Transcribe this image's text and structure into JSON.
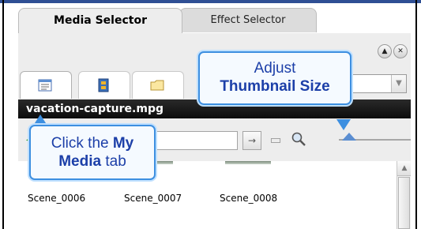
{
  "tabs": [
    {
      "label": "Media Selector",
      "active": true
    },
    {
      "label": "Effect Selector",
      "active": false
    }
  ],
  "controls": {
    "collapse_icon": "chevron-up-circle-icon",
    "close_icon": "close-circle-icon"
  },
  "icon_tabs": [
    {
      "name": "my-media",
      "icon": "list-icon"
    },
    {
      "name": "media-library",
      "icon": "film-icon"
    },
    {
      "name": "folder",
      "icon": "folder-icon"
    }
  ],
  "title_bar": {
    "text": "vacation-capture.mpg"
  },
  "toolbar": {
    "go_icon": "arrow-right-icon",
    "monitor_icon": "monitor-icon",
    "zoom_icon": "magnifier-icon"
  },
  "scenes": [
    "Scene_0006",
    "Scene_0007",
    "Scene_0008"
  ],
  "callouts": {
    "thumbnail": {
      "line1": "Adjust",
      "line2": "Thumbnail Size"
    },
    "my_media": {
      "pre": "Click the ",
      "bold1": "My",
      "bold2": "Media",
      "post": " tab"
    }
  },
  "colors": {
    "accent": "#3d8fe0",
    "callout_text": "#1c3fa8",
    "title_bar": "#111111",
    "slider_thumb": "#5b8ed1"
  }
}
